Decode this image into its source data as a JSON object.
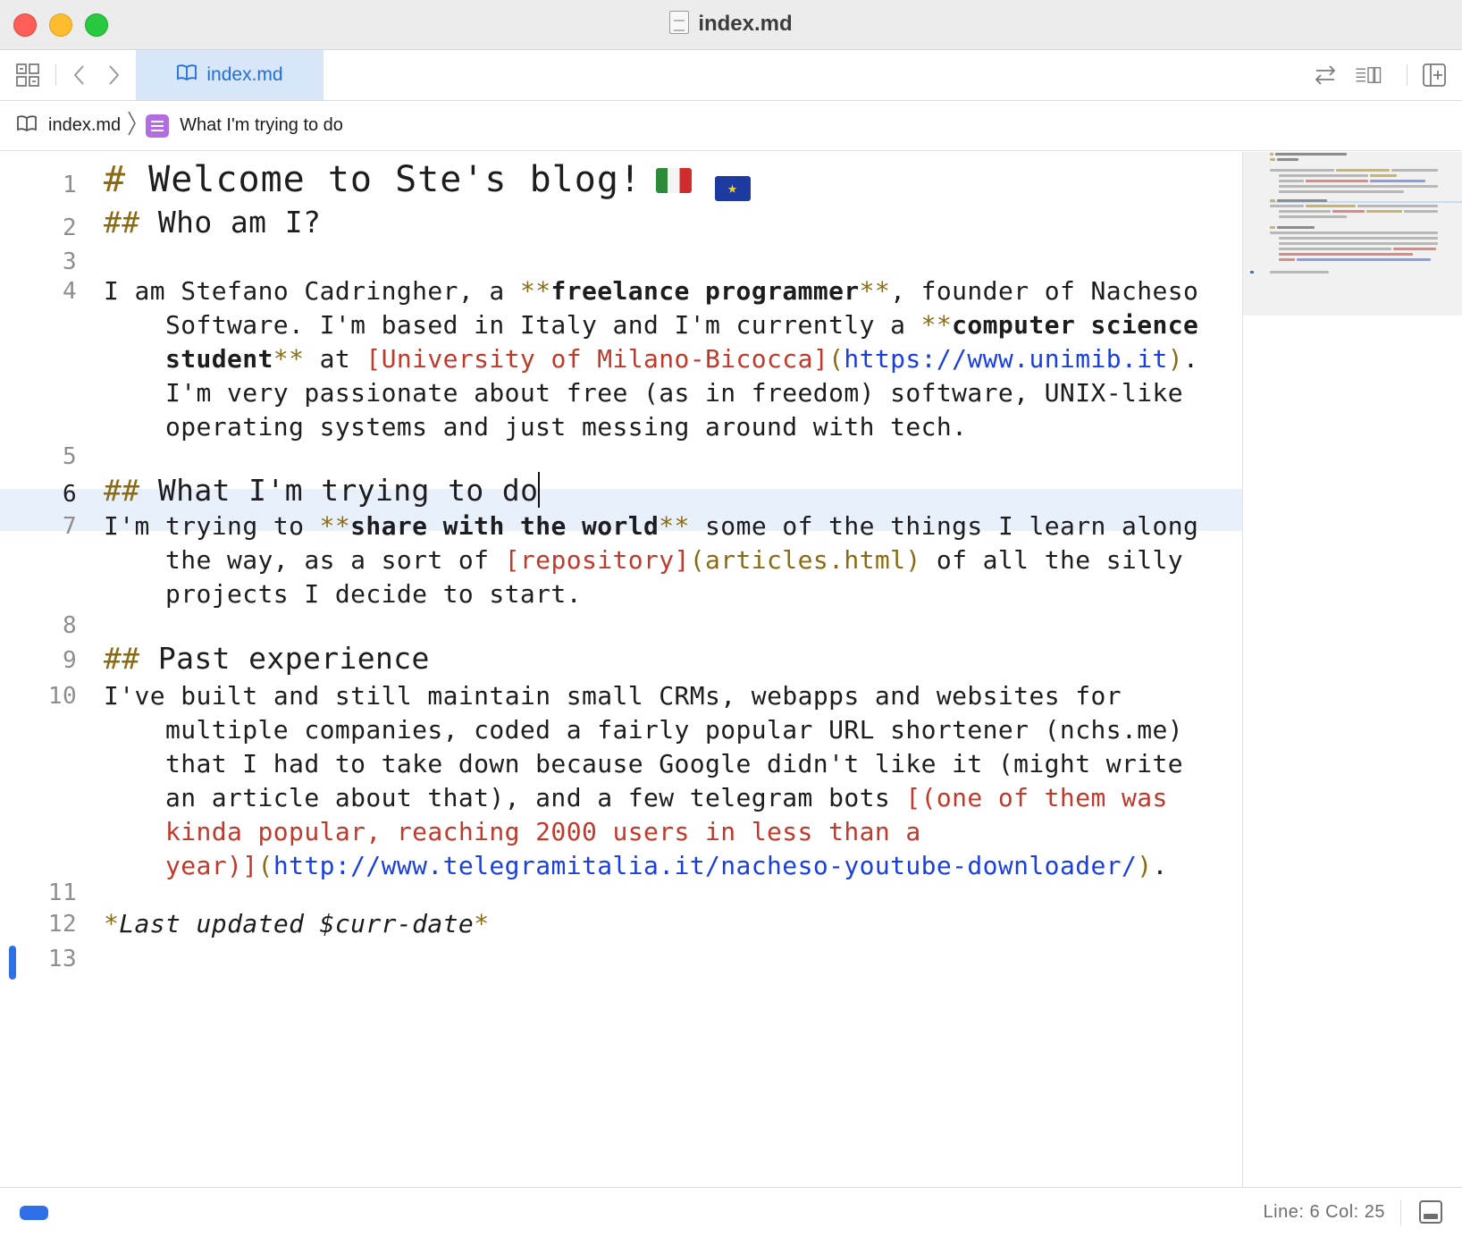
{
  "window": {
    "title": "index.md"
  },
  "tab": {
    "label": "index.md"
  },
  "breadcrumb": {
    "file": "index.md",
    "section": "What I'm trying to do"
  },
  "editor": {
    "line_numbers": [
      "1",
      "2",
      "3",
      "4",
      "5",
      "6",
      "7",
      "8",
      "9",
      "10",
      "11",
      "12",
      "13"
    ],
    "active_line": 6,
    "l1": {
      "mark": "#",
      "text": " Welcome to Ste's blog!",
      "flag_eu": "★"
    },
    "l2": {
      "mark": "##",
      "text": " Who am I?"
    },
    "l4": {
      "a": "I am Stefano Cadringher, a ",
      "b1_open": "**",
      "b1": "freelance programmer",
      "b1_close": "**",
      "c": ", founder of Nacheso",
      "d": "Software. I'm based in Italy and I'm currently a ",
      "b2_open": "**",
      "b2a": "computer science",
      "b2b": "student",
      "b2_close": "**",
      "e": " at ",
      "link_text": "[University of Milano-Bicocca]",
      "link_open": "(",
      "link_url": "https://www.unimib.it",
      "link_close": ")",
      "f": ".",
      "g": "I'm very passionate about free (as in freedom) software, UNIX-like",
      "h": "operating systems and just messing around with tech."
    },
    "l6": {
      "mark": "##",
      "text": " What I'm trying to do"
    },
    "l7": {
      "a": "I'm trying to ",
      "b_open": "**",
      "b": "share with the world",
      "b_close": "**",
      "c": " some of the things I learn along",
      "d": "the way, as a sort of ",
      "link_text": "[repository]",
      "link_url": "(articles.html)",
      "e": " of all the silly",
      "f": "projects I decide to start."
    },
    "l9": {
      "mark": "##",
      "text": " Past experience"
    },
    "l10": {
      "a": "I've built and still maintain small CRMs, webapps and websites for",
      "b": "multiple companies, coded a fairly popular URL shortener (nchs.me)",
      "c": "that I had to take down because Google didn't like it (might write",
      "d": "an article about that), and a few telegram bots ",
      "link_text_a": "[(one of them was",
      "link_text_b": "kinda popular, reaching 2000 users in less than a",
      "link_text_c": "year)]",
      "link_open": "(",
      "link_url": "http://www.telegramitalia.it/nacheso-youtube-downloader/",
      "link_close": ")",
      "e": "."
    },
    "l12": {
      "mark_open": "*",
      "text": "Last updated $curr-date",
      "mark_close": "*"
    }
  },
  "status": {
    "position": "Line: 6  Col: 25"
  },
  "colors": {
    "markdown_marker": "#8b6b12",
    "link_text": "#c0392b",
    "link_url": "#1a3fe0",
    "accent": "#2f6fe8",
    "active_line": "#e8f0fb"
  }
}
